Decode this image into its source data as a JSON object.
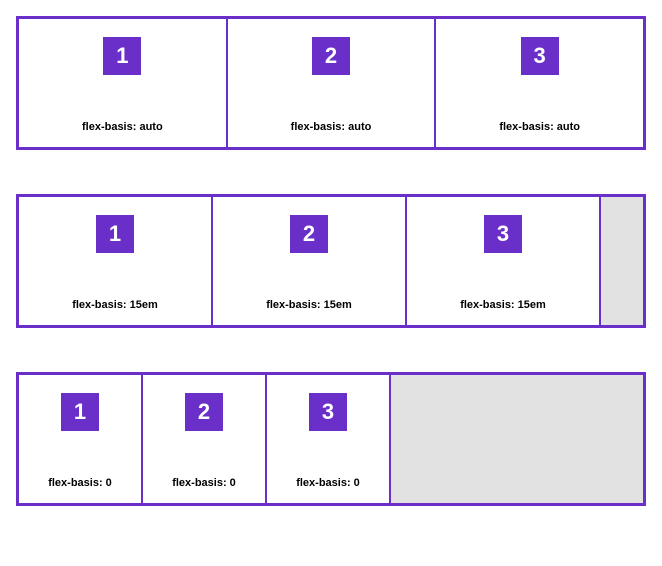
{
  "examples": [
    {
      "items": [
        {
          "num": "1",
          "caption": "flex-basis: auto"
        },
        {
          "num": "2",
          "caption": "flex-basis: auto"
        },
        {
          "num": "3",
          "caption": "flex-basis: auto"
        }
      ]
    },
    {
      "items": [
        {
          "num": "1",
          "caption": "flex-basis: 15em"
        },
        {
          "num": "2",
          "caption": "flex-basis: 15em"
        },
        {
          "num": "3",
          "caption": "flex-basis: 15em"
        }
      ]
    },
    {
      "items": [
        {
          "num": "1",
          "caption": "flex-basis: 0"
        },
        {
          "num": "2",
          "caption": "flex-basis: 0"
        },
        {
          "num": "3",
          "caption": "flex-basis: 0"
        }
      ]
    }
  ],
  "colors": {
    "accent": "#6b2fc9",
    "empty": "#e2e2e2"
  }
}
